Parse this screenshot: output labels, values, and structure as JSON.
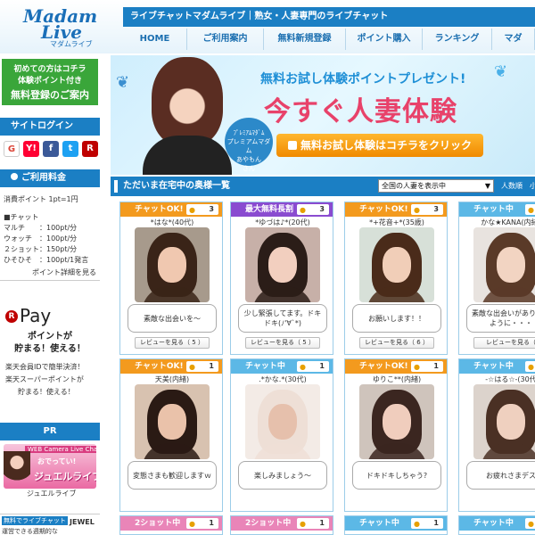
{
  "header": {
    "logo_line1": "Madam",
    "logo_line2": "Live",
    "logo_sub": "マダムライブ",
    "tagline": "ライブチャットマダムライブ｜熟女・人妻専門のライブチャット",
    "nav": [
      "HOME",
      "ご利用案内",
      "無料新規登録",
      "ポイント購入",
      "ランキング",
      "マダ"
    ]
  },
  "sidebar": {
    "promo_line1": "初めての方はコチラ",
    "promo_line2": "体験ポイント付き",
    "promo_line3": "無料登録のご案内",
    "login_title": "サイトログイン",
    "social": [
      {
        "icon": "G",
        "name": "google-icon",
        "color": "#ffffff"
      },
      {
        "icon": "Y!",
        "name": "yahoo-icon",
        "color": "#ff0033"
      },
      {
        "icon": "f",
        "name": "facebook-icon",
        "color": "#3b5998"
      },
      {
        "icon": "t",
        "name": "twitter-icon",
        "color": "#1da1f2"
      },
      {
        "icon": "R",
        "name": "rakuten-icon",
        "color": "#bf0000"
      }
    ],
    "fee_title": "ご利用料金",
    "fee_point": "消費ポイント 1pt=1円",
    "fee_lines": [
      "■チャット",
      "マルチ　　：100pt/分",
      "ウォッチ　：100pt/分",
      "２ショット：150pt/分",
      "ひそひそ　：100pt/1発言"
    ],
    "fee_more": "ポイント詳細を見る",
    "rpay_title": "Pay",
    "rpay_sub1": "ポイントが",
    "rpay_sub2": "貯まる！使える！",
    "rpay_desc1": "楽天会員IDで簡単決済！",
    "rpay_desc2": "楽天スーパーポイントが",
    "rpay_desc3": "貯まる！使える！",
    "pr_title": "PR",
    "pr_banner_top": "WEB Camera Live Chat",
    "pr_banner_main": "ジュエルライブ",
    "pr_banner_sub": "おでってい!",
    "pr_label": "ジュエルライブ",
    "pr2_line1": "無料でライブチャット",
    "pr2_line2": "運営できる週期的な",
    "pr2_logo": "JEWEL"
  },
  "banner": {
    "badge": [
      "ﾌﾟﾚﾐｱﾑﾏﾀﾞﾑ",
      "プレミアムマダム",
      "あやもん",
      "さん"
    ],
    "line1": "無料お試し体験ポイントプレゼント!",
    "line2": "今すぐ人妻体験",
    "button": "無料お試し体験はコチラをクリック"
  },
  "section": {
    "title": "ただいま在宅中の奥様一覧",
    "select": "全国の人妻を表示中",
    "right": "人数順　小"
  },
  "cards": [
    {
      "status": "チャットOK!",
      "tone": "orange",
      "count": "3",
      "name": "*はな*(40代)",
      "msg": "素敵な出会いを～",
      "review": "レビューを見る（ 5 ）",
      "hair": "#3a2418",
      "skin": "#f0c8b0",
      "bg": "#a79a8c"
    },
    {
      "status": "最大無料長割",
      "tone": "purple",
      "count": "3",
      "name": "*ゆづは♪*(20代)",
      "msg": "少し緊張してます。ドキドキ(ﾉ'∀`*)",
      "review": "レビューを見る（ 5 ）",
      "hair": "#2b1d18",
      "skin": "#f2cfbf",
      "bg": "#c7b0a8"
    },
    {
      "status": "チャットOK!",
      "tone": "orange",
      "count": "3",
      "name": "*+花音+*(35歳)",
      "msg": "お願いします！！",
      "review": "レビューを見る（ 6 ）",
      "hair": "#4a2b1a",
      "skin": "#f1ceb8",
      "bg": "#d7e0d8"
    },
    {
      "status": "チャット中",
      "tone": "blue",
      "count": "1",
      "name": "かな★KANA(内緒)",
      "msg": "素敵な出会いがありますように・・・",
      "review": "レビューを見る（",
      "hair": "#5a3a28",
      "skin": "#f2d4c2",
      "bg": "#e8e3df"
    },
    {
      "status": "チャットOK!",
      "tone": "orange",
      "count": "1",
      "name": "天美(内緒)",
      "msg": "変態さまも歓迎しますｗ",
      "review": "",
      "hair": "#2a1a14",
      "skin": "#eac2aa",
      "bg": "#d8c2b0"
    },
    {
      "status": "チャット中",
      "tone": "blue",
      "count": "1",
      "name": ".*かな.*(30代)",
      "msg": "楽しみましょう～",
      "review": "",
      "hair": "#eedfd6",
      "skin": "#e6c0ac",
      "bg": "#f3ebe6"
    },
    {
      "status": "チャットOK!",
      "tone": "orange",
      "count": "1",
      "name": "ゆりこ**(内緒)",
      "msg": "ドキドキしちゃう?",
      "review": "",
      "hair": "#3b2620",
      "skin": "#f0cdbd",
      "bg": "#cfc4bc"
    },
    {
      "status": "チャット中",
      "tone": "blue",
      "count": "1",
      "name": "-☆はる☆-(30代",
      "msg": "お疲れさまデス",
      "review": "",
      "hair": "#4a3024",
      "skin": "#efd0bf",
      "bg": "#dcd3cc"
    }
  ],
  "cards_row3": [
    {
      "status": "2ショット中",
      "tone": "pink",
      "count": "1"
    },
    {
      "status": "2ショット中",
      "tone": "pink",
      "count": "1"
    },
    {
      "status": "チャット中",
      "tone": "blue",
      "count": "1"
    },
    {
      "status": "チャット中",
      "tone": "blue",
      "count": "1"
    }
  ]
}
